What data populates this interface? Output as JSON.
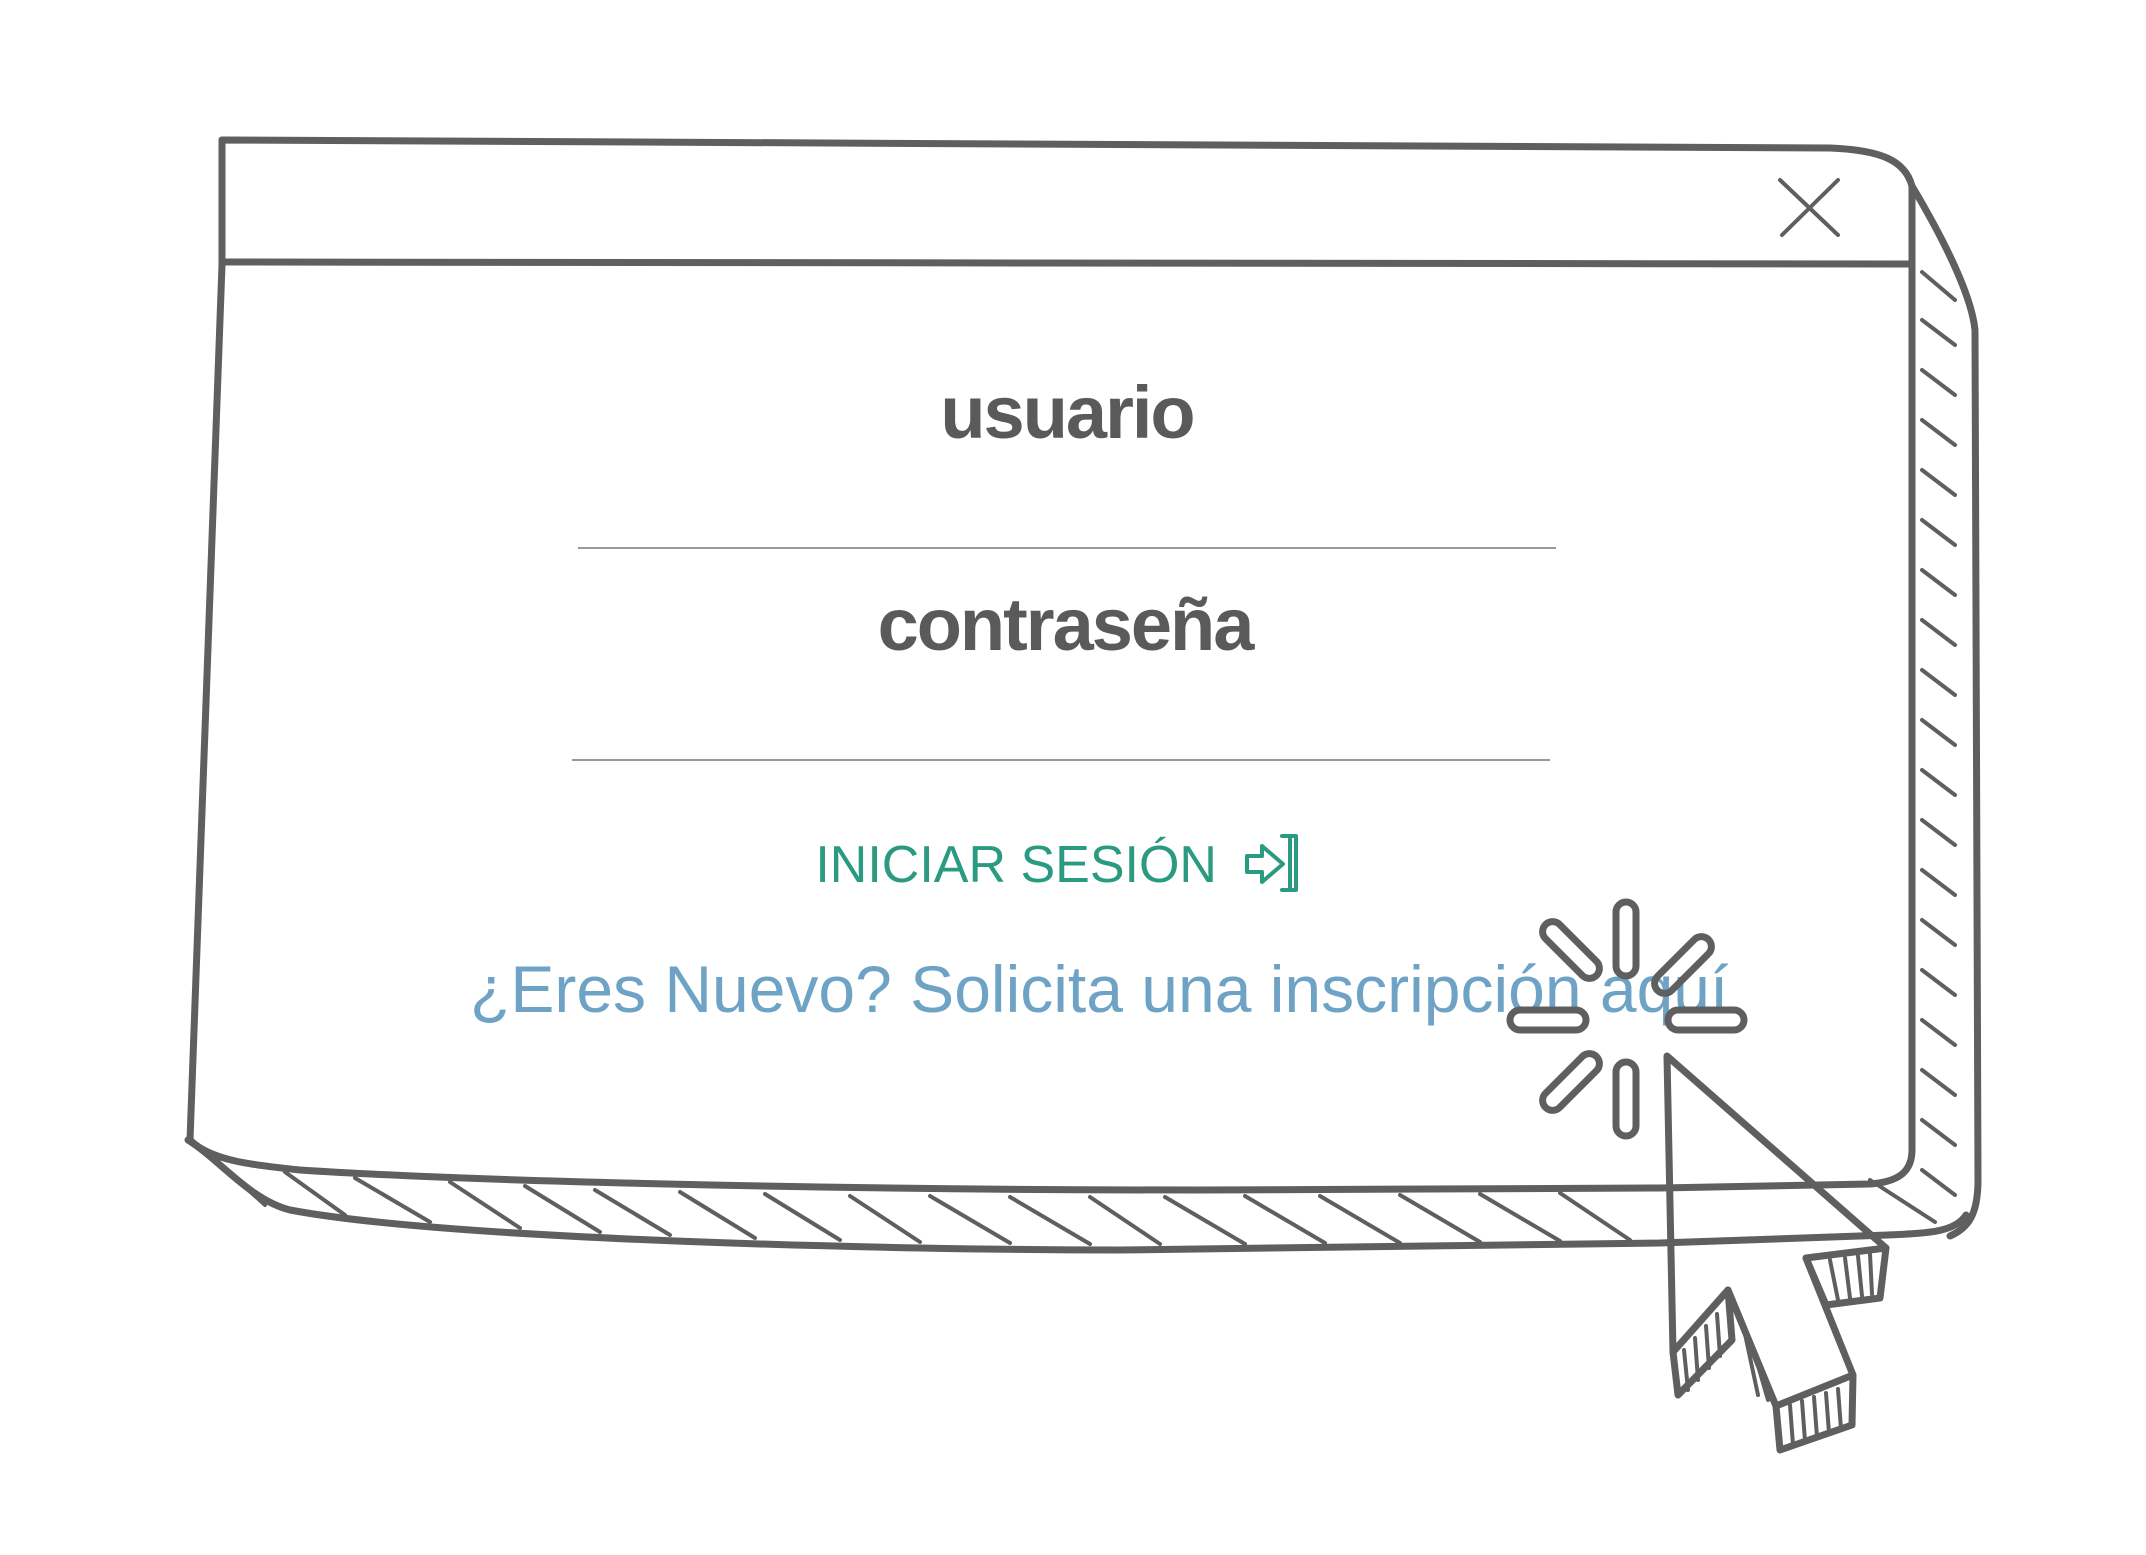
{
  "login_form": {
    "username_label": "usuario",
    "password_label": "contraseña",
    "login_button_label": "INICIAR SESIÓN",
    "signup_link_text": "¿Eres Nuevo? Solicita una inscripción aquí"
  },
  "window": {
    "close_icon": "close-icon"
  },
  "icons": {
    "login": "sign-in-icon",
    "cursor": "mouse-pointer-icon",
    "click_burst": "click-burst-icon"
  },
  "colors": {
    "outline": "#5f5f5f",
    "accent_green": "#2a9a80",
    "link_blue": "#6fa3c6",
    "field_line": "#9a9a9a"
  }
}
